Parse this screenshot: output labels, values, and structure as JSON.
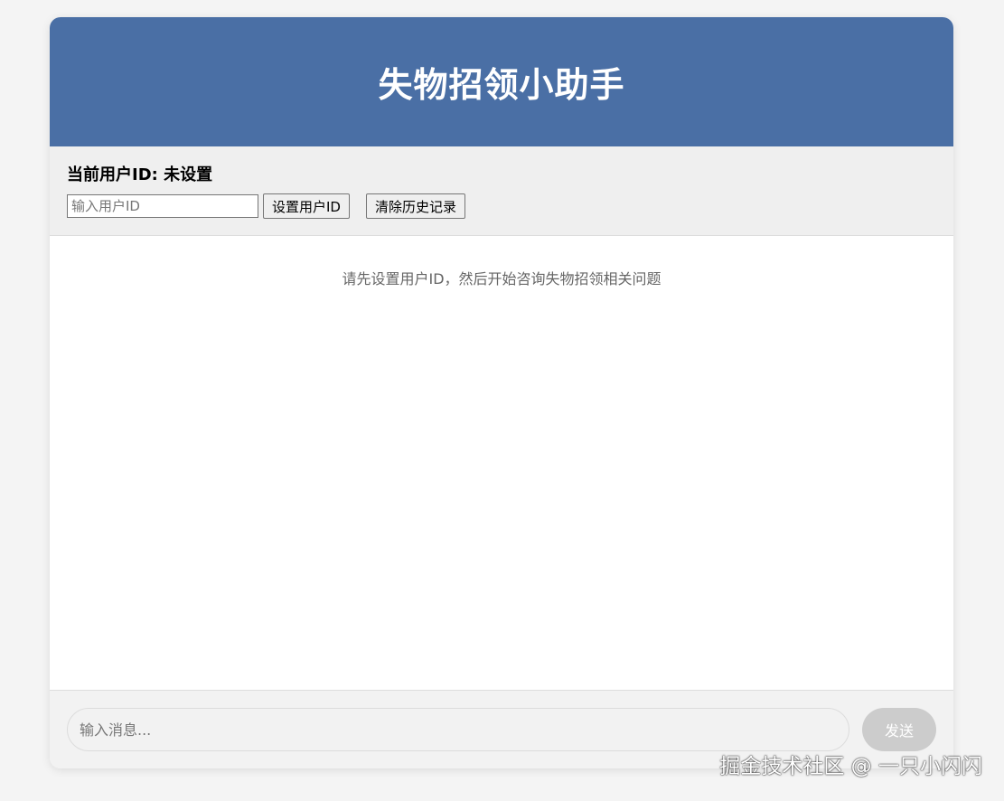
{
  "header": {
    "title": "失物招领小助手"
  },
  "user_panel": {
    "current_user_label": "当前用户ID: 未设置",
    "user_id_placeholder": "输入用户ID",
    "set_user_button": "设置用户ID",
    "clear_history_button": "清除历史记录"
  },
  "chat": {
    "hint": "请先设置用户ID，然后开始咨询失物招领相关问题"
  },
  "composer": {
    "message_placeholder": "输入消息...",
    "send_button": "发送"
  },
  "watermark": "掘金技术社区 @ 一只小闪闪",
  "colors": {
    "header_bg": "#4a6fa5",
    "panel_bg": "#efefef",
    "send_disabled": "#cccccc"
  }
}
